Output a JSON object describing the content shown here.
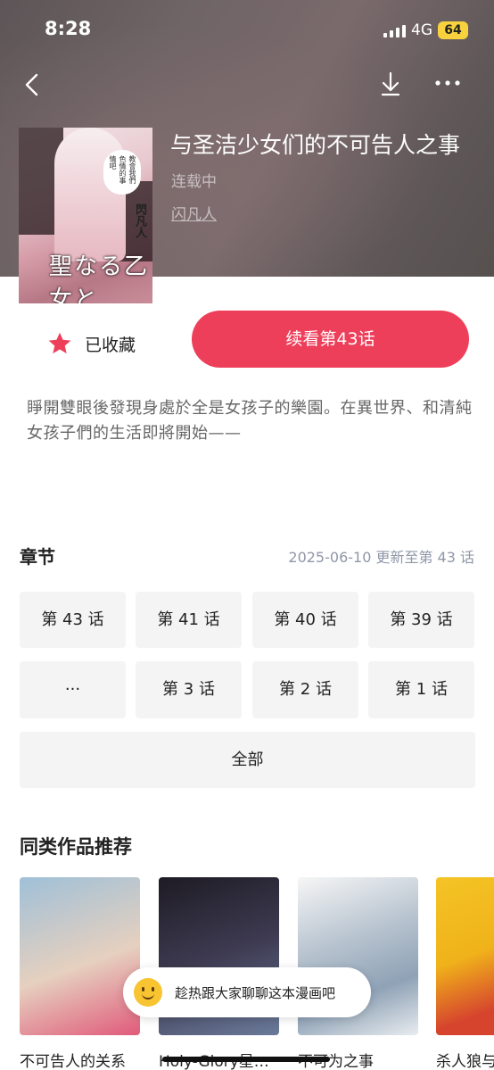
{
  "status_bar": {
    "time": "8:28",
    "network": "4G",
    "battery": "64"
  },
  "comic": {
    "title": "与圣洁少女们的不可告人之事",
    "status": "连载中",
    "author": "闪凡人",
    "cover_title": "聖なる乙女と",
    "cover_author": "閃凡人",
    "cover_bubble": "教會我們色情的事情吧",
    "description": "睜開雙眼後發現身處於全是女孩子的樂園。在異世界、和清純女孩子們的生活即將開始——"
  },
  "actions": {
    "favorite_label": "已收藏",
    "read_label": "续看第43话"
  },
  "chapters": {
    "header": "章节",
    "update": "2025-06-10 更新至第 43 话",
    "row1": [
      "第 43 话",
      "第 41 话",
      "第 40 话",
      "第 39 话"
    ],
    "row2": [
      "···",
      "第 3 话",
      "第 2 话",
      "第 1 话"
    ],
    "all_label": "全部"
  },
  "recommend": {
    "header": "同类作品推荐",
    "items": [
      "不可告人的关系",
      "Holy-Glory星…",
      "不可为之事",
      "杀人狼与"
    ]
  },
  "chat_prompt": "趁热跟大家聊聊这本漫画吧",
  "colors": {
    "accent": "#ee3f5a",
    "muted_blue": "#8f97a8"
  }
}
